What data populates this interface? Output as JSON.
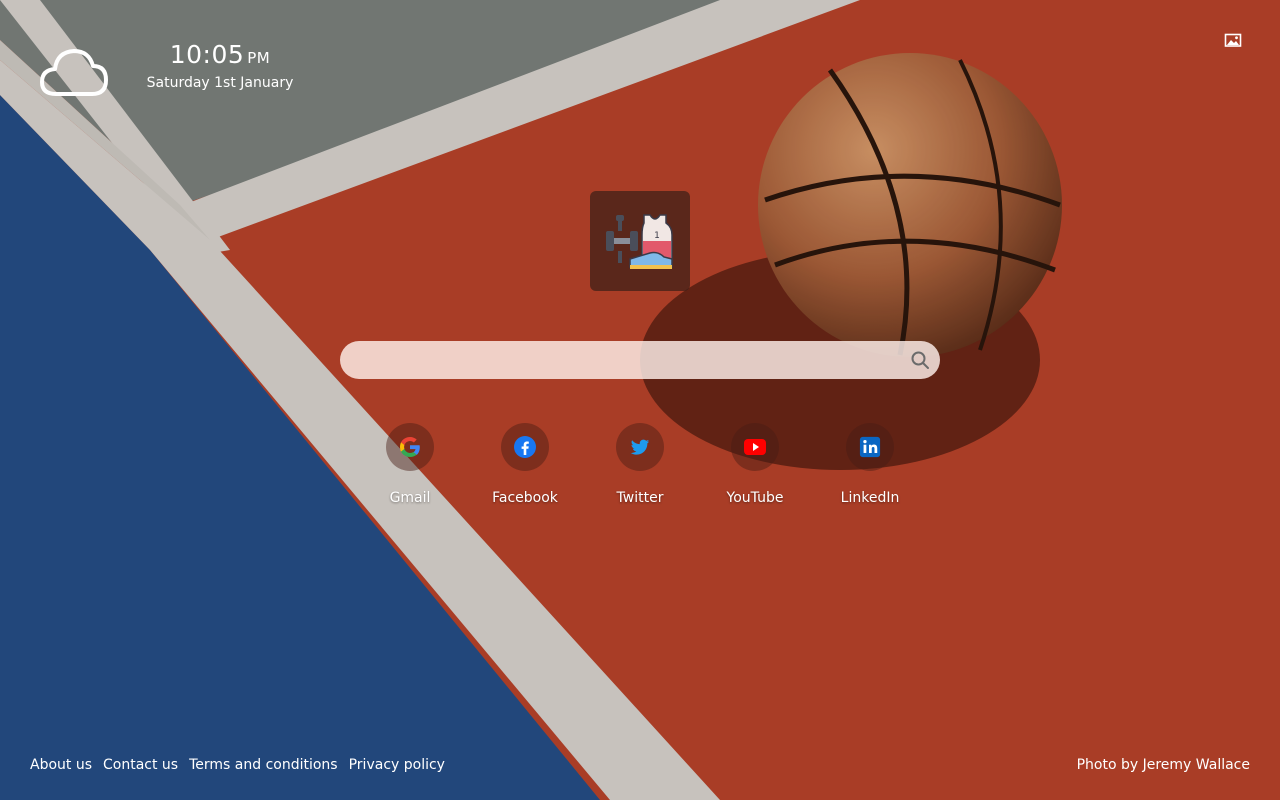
{
  "clock": {
    "time": "10:05",
    "ampm": "PM",
    "date": "Saturday 1st January"
  },
  "weather": {
    "icon": "cloud-icon"
  },
  "toolbar": {
    "background_icon": "image-icon"
  },
  "logo": {
    "icon": "sports-gear-icon",
    "jersey_number": "1"
  },
  "search": {
    "placeholder": "",
    "value": "",
    "icon": "search-icon"
  },
  "shortcuts": [
    {
      "label": "Gmail",
      "icon": "google-icon"
    },
    {
      "label": "Facebook",
      "icon": "facebook-icon"
    },
    {
      "label": "Twitter",
      "icon": "twitter-icon"
    },
    {
      "label": "YouTube",
      "icon": "youtube-icon"
    },
    {
      "label": "LinkedIn",
      "icon": "linkedin-icon"
    }
  ],
  "footer": {
    "links": [
      "About us",
      "Contact us",
      "Terms and conditions",
      "Privacy policy"
    ],
    "credit": "Photo by Jeremy Wallace"
  },
  "colors": {
    "court_red": "#b8432a",
    "court_blue": "#254e86",
    "court_gray": "#7b807c",
    "court_line": "#d8d3ce",
    "ball": "#b06a40"
  }
}
